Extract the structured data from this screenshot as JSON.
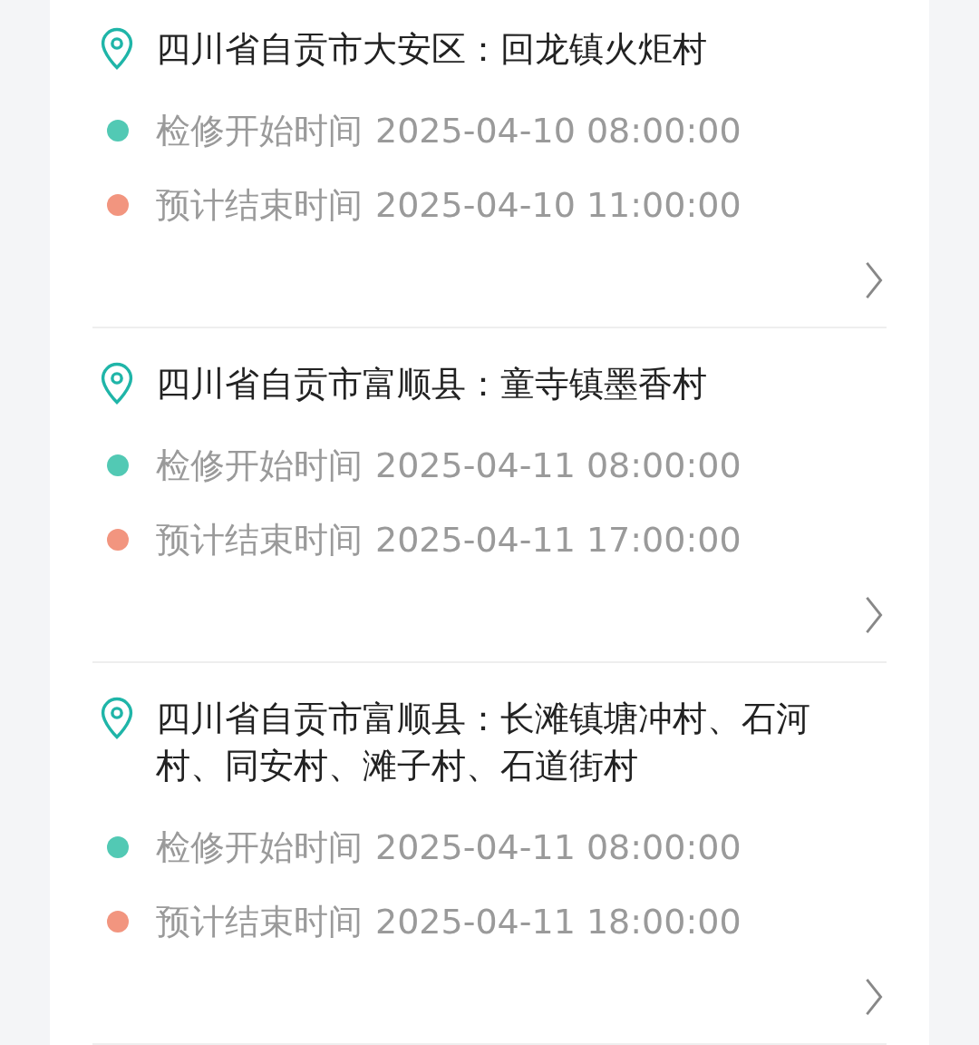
{
  "outages": [
    {
      "location": "四川省自贡市大安区：回龙镇火炬村",
      "times": [
        {
          "label": "检修开始时间",
          "time": "2025-04-10 08:00:00",
          "color": "#52c9b4"
        },
        {
          "label": "预计结束时间",
          "time": "2025-04-10 11:00:00",
          "color": "#f2957f"
        }
      ]
    },
    {
      "location": "四川省自贡市富顺县：童寺镇墨香村",
      "times": [
        {
          "label": "检修开始时间",
          "time": "2025-04-11 08:00:00",
          "color": "#52c9b4"
        },
        {
          "label": "预计结束时间",
          "time": "2025-04-11 17:00:00",
          "color": "#f2957f"
        }
      ]
    },
    {
      "location": "四川省自贡市富顺县：长滩镇塘冲村、石河村、同安村、滩子村、石道街村",
      "times": [
        {
          "label": "检修开始时间",
          "time": "2025-04-11 08:00:00",
          "color": "#52c9b4"
        },
        {
          "label": "预计结束时间",
          "time": "2025-04-11 18:00:00",
          "color": "#f2957f"
        }
      ]
    }
  ]
}
